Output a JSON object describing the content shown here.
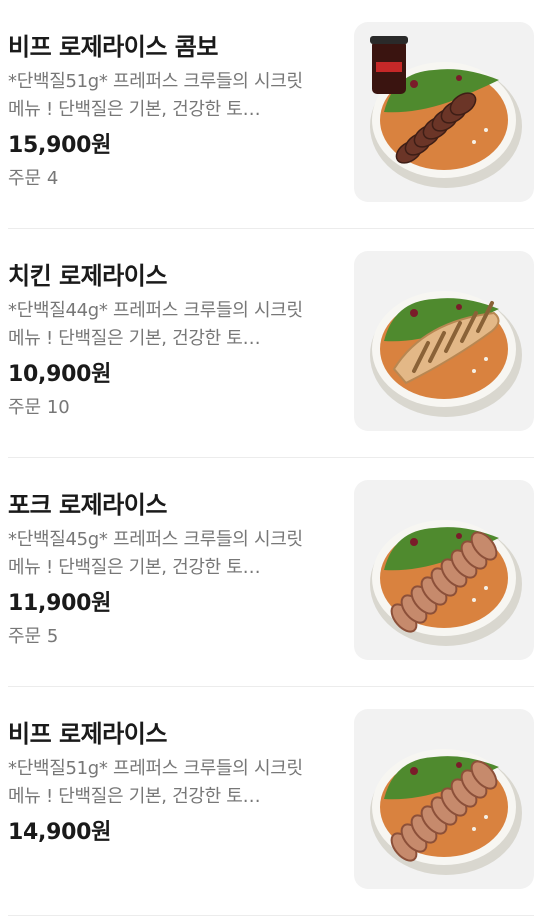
{
  "menu": {
    "items": [
      {
        "name": "비프 로제라이스 콤보",
        "desc": "*단백질51g* 프레퍼스 크루들의 시크릿 메뉴 ! 단백질은 기본, 건강한 토…",
        "price": "15,900원",
        "orders_label": "주문 4",
        "image": "beef-combo-bowl",
        "protein": "steak",
        "has_drink": true
      },
      {
        "name": "치킨 로제라이스",
        "desc": "*단백질44g* 프레퍼스 크루들의 시크릿 메뉴 ! 단백질은 기본, 건강한 토…",
        "price": "10,900원",
        "orders_label": "주문 10",
        "image": "chicken-bowl",
        "protein": "chicken",
        "has_drink": false
      },
      {
        "name": "포크 로제라이스",
        "desc": "*단백질45g* 프레퍼스 크루들의 시크릿 메뉴 ! 단백질은 기본, 건강한 토…",
        "price": "11,900원",
        "orders_label": "주문 5",
        "image": "pork-bowl",
        "protein": "pork",
        "has_drink": false
      },
      {
        "name": "비프 로제라이스",
        "desc": "*단백질51g* 프레퍼스 크루들의 시크릿 메뉴 ! 단백질은 기본, 건강한 토…",
        "price": "14,900원",
        "orders_label": "",
        "image": "beef-bowl",
        "protein": "pork",
        "has_drink": false
      }
    ]
  },
  "colors": {
    "title": "#1a1a1a",
    "muted": "#777777",
    "thumb_bg": "#f2f2f2",
    "rice": "#d9823f",
    "greens": "#4f8a2e",
    "bowl": "#f7f6f2"
  }
}
